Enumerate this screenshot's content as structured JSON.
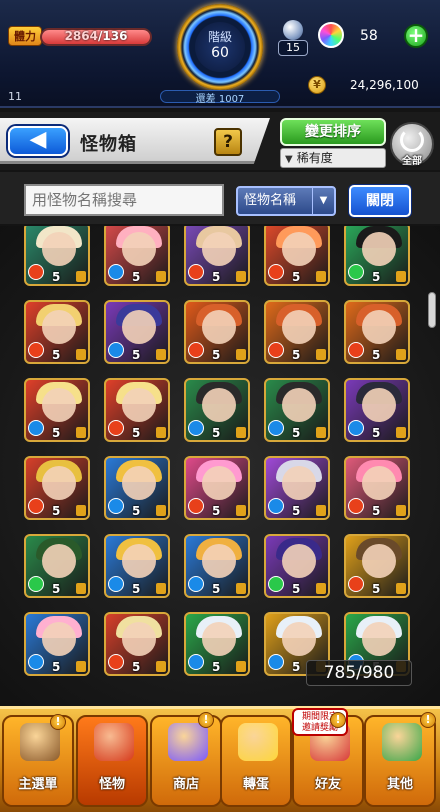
{
  "status": {
    "stamina_label": "體力",
    "stamina_current": "2864",
    "stamina_max": "/136",
    "stamina_level": 1.0,
    "rank_label": "階級",
    "rank_value": "60",
    "exp_remaining": "還差 1007",
    "left_value": "11",
    "egg_count": "15",
    "orb_count": "58",
    "gold": "24,296,100",
    "plus_symbol": "+"
  },
  "header": {
    "title": "怪物箱",
    "back_symbol": "◀",
    "help_symbol": "?",
    "sort_button": "變更排序",
    "sort_selected": "稀有度",
    "all_label": "全部"
  },
  "search": {
    "placeholder": "用怪物名稱搜尋",
    "field_selected": "怪物名稱",
    "close_label": "關閉"
  },
  "box": {
    "counter": "785/980",
    "monsters": [
      {
        "element": "fire",
        "level": "5",
        "bg": "#2a8a6a",
        "hair": "#f2e6c8"
      },
      {
        "element": "water",
        "level": "5",
        "bg": "#d84a4a",
        "hair": "#ffb0c0"
      },
      {
        "element": "fire",
        "level": "5",
        "bg": "#7a4ab8",
        "hair": "#e8c8a0"
      },
      {
        "element": "fire",
        "level": "5",
        "bg": "#e04a2a",
        "hair": "#ff9a5a"
      },
      {
        "element": "wood",
        "level": "5",
        "bg": "#2aa85a",
        "hair": "#1a1a1a"
      },
      {
        "element": "fire",
        "level": "5",
        "bg": "#e0402a",
        "hair": "#f2d070"
      },
      {
        "element": "water",
        "level": "5",
        "bg": "#7a3ab8",
        "hair": "#3a3a9a"
      },
      {
        "element": "fire",
        "level": "5",
        "bg": "#e05a1a",
        "hair": "#d8602a"
      },
      {
        "element": "fire",
        "level": "5",
        "bg": "#e06a1a",
        "hair": "#d8602a"
      },
      {
        "element": "fire",
        "level": "5",
        "bg": "#e06a1a",
        "hair": "#d8602a"
      },
      {
        "element": "water",
        "level": "5",
        "bg": "#e0402a",
        "hair": "#f6e08a"
      },
      {
        "element": "fire",
        "level": "5",
        "bg": "#e0402a",
        "hair": "#f6e08a"
      },
      {
        "element": "water",
        "level": "5",
        "bg": "#2a8a4a",
        "hair": "#2a2a2a"
      },
      {
        "element": "water",
        "level": "5",
        "bg": "#2a8a4a",
        "hair": "#2a2a2a"
      },
      {
        "element": "water",
        "level": "5",
        "bg": "#7a3ab8",
        "hair": "#2a2a3a"
      },
      {
        "element": "fire",
        "level": "5",
        "bg": "#d8402a",
        "hair": "#e8c040"
      },
      {
        "element": "water",
        "level": "5",
        "bg": "#2a7ad8",
        "hair": "#f0c040"
      },
      {
        "element": "fire",
        "level": "5",
        "bg": "#e04a8a",
        "hair": "#ff9ad0"
      },
      {
        "element": "water",
        "level": "5",
        "bg": "#a04ad8",
        "hair": "#d8d8e8"
      },
      {
        "element": "fire",
        "level": "5",
        "bg": "#e05a7a",
        "hair": "#ff8ab0"
      },
      {
        "element": "wood",
        "level": "5",
        "bg": "#2a8a4a",
        "hair": "#2a5a2a"
      },
      {
        "element": "water",
        "level": "5",
        "bg": "#2a7ad8",
        "hair": "#f0c040"
      },
      {
        "element": "water",
        "level": "5",
        "bg": "#2a7ad8",
        "hair": "#f0b040"
      },
      {
        "element": "wood",
        "level": "5",
        "bg": "#7a3ab8",
        "hair": "#3a2a8a"
      },
      {
        "element": "fire",
        "level": "5",
        "bg": "#e0a01a",
        "hair": "#6a4a2a"
      },
      {
        "element": "water",
        "level": "5",
        "bg": "#2a7ad8",
        "hair": "#ffb0d0"
      },
      {
        "element": "fire",
        "level": "5",
        "bg": "#d8402a",
        "hair": "#f0e0a0"
      },
      {
        "element": "water",
        "level": "5",
        "bg": "#2aa84a",
        "hair": "#e8f0f8"
      },
      {
        "element": "water",
        "level": "5",
        "bg": "#e0a01a",
        "hair": "#e8f0f8"
      },
      {
        "element": "water",
        "level": "5",
        "bg": "#2aa84a",
        "hair": "#e8f0f8"
      }
    ]
  },
  "nav": {
    "items": [
      {
        "label": "主選單",
        "icon": "house-icon",
        "color": "#8a5a2a"
      },
      {
        "label": "怪物",
        "icon": "monster-icon",
        "color": "#d83a1a"
      },
      {
        "label": "商店",
        "icon": "orb-icon",
        "color": "#7a5bff"
      },
      {
        "label": "轉蛋",
        "icon": "egg-icon",
        "color": "#ffd83a"
      },
      {
        "label": "好友",
        "icon": "friends-icon",
        "color": "#d83a3a"
      },
      {
        "label": "其他",
        "icon": "question-icon",
        "color": "#3aa84a"
      }
    ],
    "event_notice": "期間限定\n邀請獎勵",
    "badge": "!"
  },
  "colors": {
    "fire": "#e8401a",
    "water": "#1a8ae8",
    "wood": "#2ac84a"
  }
}
